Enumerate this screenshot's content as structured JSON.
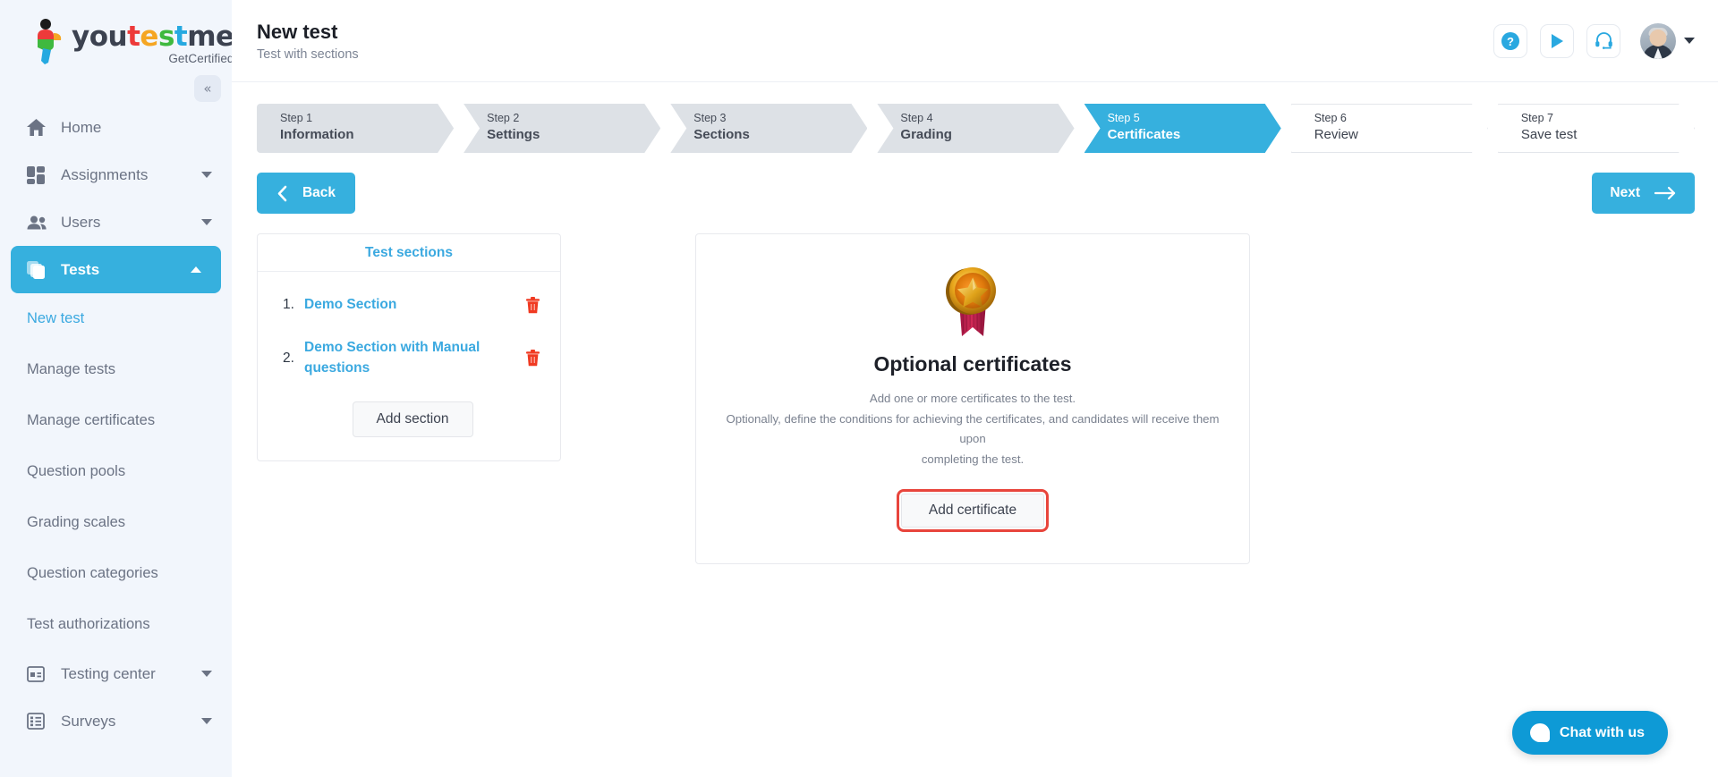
{
  "brand": {
    "name_parts": [
      {
        "text": "you",
        "color": "#3c4250"
      },
      {
        "text": "t",
        "color": "#ed3a3a"
      },
      {
        "text": "e",
        "color": "#f5a623"
      },
      {
        "text": "s",
        "color": "#3fb93f"
      },
      {
        "text": "t",
        "color": "#26a9e0"
      },
      {
        "text": "me",
        "color": "#3c4250"
      }
    ],
    "name_plain": "youtestme",
    "tagline": "GetCertified",
    "accent": "#36b0de",
    "danger": "#e8453c"
  },
  "sidebar": {
    "collapse_label": "«",
    "items": [
      {
        "label": "Home",
        "icon": "home-icon",
        "has_caret": false,
        "active": false
      },
      {
        "label": "Assignments",
        "icon": "assignments-icon",
        "has_caret": true,
        "active": false
      },
      {
        "label": "Users",
        "icon": "users-icon",
        "has_caret": true,
        "active": false
      },
      {
        "label": "Tests",
        "icon": "tests-icon",
        "has_caret": true,
        "active": true
      }
    ],
    "sub_items": [
      {
        "label": "New test",
        "selected": true
      },
      {
        "label": "Manage tests",
        "selected": false
      },
      {
        "label": "Manage certificates",
        "selected": false
      },
      {
        "label": "Question pools",
        "selected": false
      },
      {
        "label": "Grading scales",
        "selected": false
      },
      {
        "label": "Question categories",
        "selected": false
      },
      {
        "label": "Test authorizations",
        "selected": false
      }
    ],
    "bottom_items": [
      {
        "label": "Testing center",
        "icon": "testing-center-icon",
        "has_caret": true
      },
      {
        "label": "Surveys",
        "icon": "surveys-icon",
        "has_caret": true
      }
    ]
  },
  "header": {
    "title": "New test",
    "subtitle": "Test with sections",
    "actions": [
      {
        "name": "help-icon",
        "glyph": "?"
      },
      {
        "name": "play-icon",
        "glyph": "▶"
      },
      {
        "name": "headset-icon",
        "glyph": "headset"
      }
    ]
  },
  "wizard": {
    "steps": [
      {
        "num": "Step 1",
        "name": "Information",
        "state": "done"
      },
      {
        "num": "Step 2",
        "name": "Settings",
        "state": "done"
      },
      {
        "num": "Step 3",
        "name": "Sections",
        "state": "done"
      },
      {
        "num": "Step 4",
        "name": "Grading",
        "state": "done"
      },
      {
        "num": "Step 5",
        "name": "Certificates",
        "state": "active"
      },
      {
        "num": "Step 6",
        "name": "Review",
        "state": "future"
      },
      {
        "num": "Step 7",
        "name": "Save test",
        "state": "future"
      }
    ]
  },
  "nav_buttons": {
    "back": "Back",
    "next": "Next"
  },
  "sections_panel": {
    "title": "Test sections",
    "items": [
      {
        "index": "1.",
        "name": "Demo Section"
      },
      {
        "index": "2.",
        "name": "Demo Section with Manual questions"
      }
    ],
    "add_label": "Add section"
  },
  "certificates_panel": {
    "icon": "medal-icon",
    "title": "Optional certificates",
    "description_line1": "Add one or more certificates to the test.",
    "description_line2": "Optionally, define the conditions for achieving the certificates, and candidates will receive them upon",
    "description_line3": "completing the test.",
    "add_label": "Add certificate",
    "add_highlight_color": "#e8453c"
  },
  "chat": {
    "label": "Chat with us",
    "icon": "chat-bubble-icon"
  }
}
